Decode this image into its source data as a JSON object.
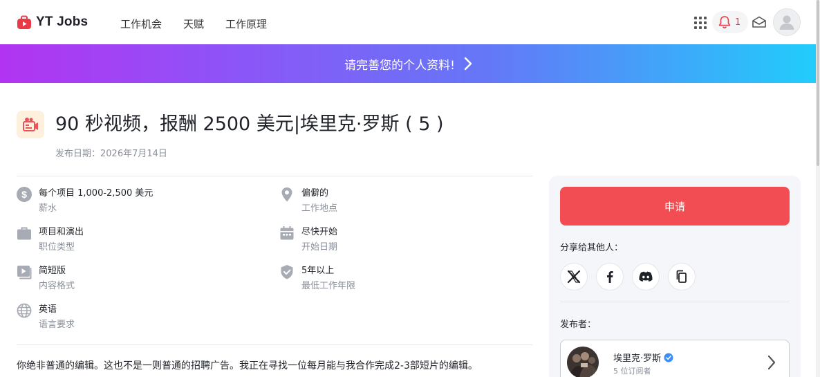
{
  "header": {
    "logo_text": "YT Jobs",
    "nav": [
      "工作机会",
      "天赋",
      "工作原理"
    ],
    "notification_count": "1",
    "brand_color": "#e83b45"
  },
  "banner": {
    "text": "请完善您的个人资料!"
  },
  "job": {
    "title": "90 秒视频，报酬 2500 美元|埃里克·罗斯 ( 5 )",
    "posted": "发布日期：2026年7月14日"
  },
  "details": [
    {
      "icon": "dollar-icon",
      "value": "每个项目 1,000-2,500 美元",
      "label": "薪水"
    },
    {
      "icon": "location-pin-icon",
      "value": "偏僻的",
      "label": "工作地点"
    },
    {
      "icon": "briefcase-icon",
      "value": "项目和演出",
      "label": "职位类型"
    },
    {
      "icon": "calendar-icon",
      "value": "尽快开始",
      "label": "开始日期"
    },
    {
      "icon": "video-play-icon",
      "value": "简短版",
      "label": "内容格式"
    },
    {
      "icon": "shield-check-icon",
      "value": "5年以上",
      "label": "最低工作年限"
    },
    {
      "icon": "globe-icon",
      "value": "英语",
      "label": "语言要求"
    }
  ],
  "description": "你绝非普通的编辑。这也不是一则普通的招聘广告。我正在寻找一位每月能与我合作完成2-3部短片的编辑。",
  "sidebar": {
    "apply_label": "申请",
    "apply_color": "#f24d52",
    "share_label": "分享给其他人：",
    "share_buttons": [
      "x-icon",
      "facebook-icon",
      "discord-icon",
      "copy-icon"
    ],
    "publisher_label": "发布者：",
    "publisher": {
      "name": "埃里克·罗斯",
      "subscribers": "5 位订阅者",
      "verified": true
    }
  }
}
